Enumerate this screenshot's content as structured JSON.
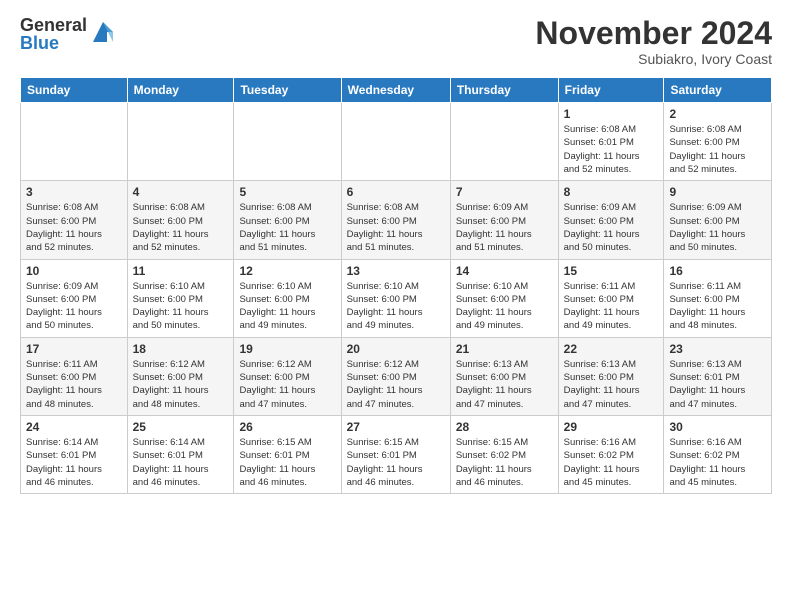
{
  "header": {
    "logo_general": "General",
    "logo_blue": "Blue",
    "month_title": "November 2024",
    "location": "Subiakro, Ivory Coast"
  },
  "calendar": {
    "days_of_week": [
      "Sunday",
      "Monday",
      "Tuesday",
      "Wednesday",
      "Thursday",
      "Friday",
      "Saturday"
    ],
    "weeks": [
      [
        {
          "day": "",
          "info": ""
        },
        {
          "day": "",
          "info": ""
        },
        {
          "day": "",
          "info": ""
        },
        {
          "day": "",
          "info": ""
        },
        {
          "day": "",
          "info": ""
        },
        {
          "day": "1",
          "info": "Sunrise: 6:08 AM\nSunset: 6:01 PM\nDaylight: 11 hours\nand 52 minutes."
        },
        {
          "day": "2",
          "info": "Sunrise: 6:08 AM\nSunset: 6:00 PM\nDaylight: 11 hours\nand 52 minutes."
        }
      ],
      [
        {
          "day": "3",
          "info": "Sunrise: 6:08 AM\nSunset: 6:00 PM\nDaylight: 11 hours\nand 52 minutes."
        },
        {
          "day": "4",
          "info": "Sunrise: 6:08 AM\nSunset: 6:00 PM\nDaylight: 11 hours\nand 52 minutes."
        },
        {
          "day": "5",
          "info": "Sunrise: 6:08 AM\nSunset: 6:00 PM\nDaylight: 11 hours\nand 51 minutes."
        },
        {
          "day": "6",
          "info": "Sunrise: 6:08 AM\nSunset: 6:00 PM\nDaylight: 11 hours\nand 51 minutes."
        },
        {
          "day": "7",
          "info": "Sunrise: 6:09 AM\nSunset: 6:00 PM\nDaylight: 11 hours\nand 51 minutes."
        },
        {
          "day": "8",
          "info": "Sunrise: 6:09 AM\nSunset: 6:00 PM\nDaylight: 11 hours\nand 50 minutes."
        },
        {
          "day": "9",
          "info": "Sunrise: 6:09 AM\nSunset: 6:00 PM\nDaylight: 11 hours\nand 50 minutes."
        }
      ],
      [
        {
          "day": "10",
          "info": "Sunrise: 6:09 AM\nSunset: 6:00 PM\nDaylight: 11 hours\nand 50 minutes."
        },
        {
          "day": "11",
          "info": "Sunrise: 6:10 AM\nSunset: 6:00 PM\nDaylight: 11 hours\nand 50 minutes."
        },
        {
          "day": "12",
          "info": "Sunrise: 6:10 AM\nSunset: 6:00 PM\nDaylight: 11 hours\nand 49 minutes."
        },
        {
          "day": "13",
          "info": "Sunrise: 6:10 AM\nSunset: 6:00 PM\nDaylight: 11 hours\nand 49 minutes."
        },
        {
          "day": "14",
          "info": "Sunrise: 6:10 AM\nSunset: 6:00 PM\nDaylight: 11 hours\nand 49 minutes."
        },
        {
          "day": "15",
          "info": "Sunrise: 6:11 AM\nSunset: 6:00 PM\nDaylight: 11 hours\nand 49 minutes."
        },
        {
          "day": "16",
          "info": "Sunrise: 6:11 AM\nSunset: 6:00 PM\nDaylight: 11 hours\nand 48 minutes."
        }
      ],
      [
        {
          "day": "17",
          "info": "Sunrise: 6:11 AM\nSunset: 6:00 PM\nDaylight: 11 hours\nand 48 minutes."
        },
        {
          "day": "18",
          "info": "Sunrise: 6:12 AM\nSunset: 6:00 PM\nDaylight: 11 hours\nand 48 minutes."
        },
        {
          "day": "19",
          "info": "Sunrise: 6:12 AM\nSunset: 6:00 PM\nDaylight: 11 hours\nand 47 minutes."
        },
        {
          "day": "20",
          "info": "Sunrise: 6:12 AM\nSunset: 6:00 PM\nDaylight: 11 hours\nand 47 minutes."
        },
        {
          "day": "21",
          "info": "Sunrise: 6:13 AM\nSunset: 6:00 PM\nDaylight: 11 hours\nand 47 minutes."
        },
        {
          "day": "22",
          "info": "Sunrise: 6:13 AM\nSunset: 6:00 PM\nDaylight: 11 hours\nand 47 minutes."
        },
        {
          "day": "23",
          "info": "Sunrise: 6:13 AM\nSunset: 6:01 PM\nDaylight: 11 hours\nand 47 minutes."
        }
      ],
      [
        {
          "day": "24",
          "info": "Sunrise: 6:14 AM\nSunset: 6:01 PM\nDaylight: 11 hours\nand 46 minutes."
        },
        {
          "day": "25",
          "info": "Sunrise: 6:14 AM\nSunset: 6:01 PM\nDaylight: 11 hours\nand 46 minutes."
        },
        {
          "day": "26",
          "info": "Sunrise: 6:15 AM\nSunset: 6:01 PM\nDaylight: 11 hours\nand 46 minutes."
        },
        {
          "day": "27",
          "info": "Sunrise: 6:15 AM\nSunset: 6:01 PM\nDaylight: 11 hours\nand 46 minutes."
        },
        {
          "day": "28",
          "info": "Sunrise: 6:15 AM\nSunset: 6:02 PM\nDaylight: 11 hours\nand 46 minutes."
        },
        {
          "day": "29",
          "info": "Sunrise: 6:16 AM\nSunset: 6:02 PM\nDaylight: 11 hours\nand 45 minutes."
        },
        {
          "day": "30",
          "info": "Sunrise: 6:16 AM\nSunset: 6:02 PM\nDaylight: 11 hours\nand 45 minutes."
        }
      ]
    ]
  }
}
